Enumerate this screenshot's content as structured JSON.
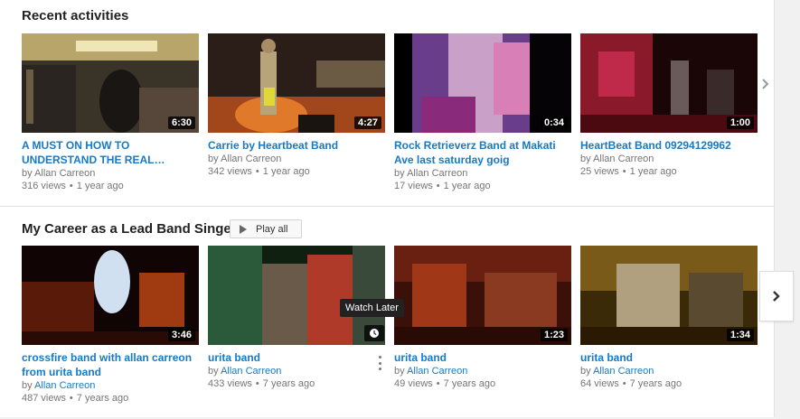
{
  "sections": [
    {
      "title": "Recent activities",
      "videos": [
        {
          "title": "A MUST ON HOW TO UNDERSTAND THE REAL…",
          "author": "Allan Carreon",
          "views": "316 views",
          "age": "1 year ago",
          "duration": "6:30"
        },
        {
          "title": "Carrie by Heartbeat Band",
          "author": "Allan Carreon",
          "views": "342 views",
          "age": "1 year ago",
          "duration": "4:27"
        },
        {
          "title": "Rock Retrieverz Band at Makati Ave last saturday goig",
          "author": "Allan Carreon",
          "views": "17 views",
          "age": "1 year ago",
          "duration": "0:34"
        },
        {
          "title": "HeartBeat Band 09294129962",
          "author": "Allan Carreon",
          "views": "25 views",
          "age": "1 year ago",
          "duration": "1:00"
        }
      ]
    },
    {
      "title": "My Career as a Lead Band Singer",
      "play_all": "Play all",
      "videos": [
        {
          "title": "crossfire band with allan carreon from urita band",
          "author": "Allan Carreon",
          "views": "487 views",
          "age": "7 years ago",
          "duration": "3:46"
        },
        {
          "title": "urita band",
          "author": "Allan Carreon",
          "views": "433 views",
          "age": "7 years ago",
          "duration": ""
        },
        {
          "title": "urita band",
          "author": "Allan Carreon",
          "views": "49 views",
          "age": "7 years ago",
          "duration": "1:23"
        },
        {
          "title": "urita band",
          "author": "Allan Carreon",
          "views": "64 views",
          "age": "7 years ago",
          "duration": "1:34"
        }
      ]
    }
  ],
  "by_prefix": "by",
  "dot": "•",
  "tooltip": "Watch Later"
}
